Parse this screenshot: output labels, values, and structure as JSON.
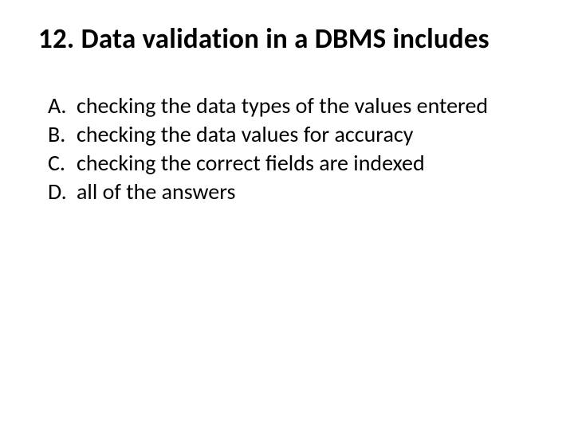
{
  "q": {
    "num": "12.",
    "text": "Data validation in a DBMS includes"
  },
  "o": [
    {
      "l": "A.",
      "t": "checking the data types of the values entered"
    },
    {
      "l": "B.",
      "t": "checking the data values for accuracy"
    },
    {
      "l": "C.",
      "t": "checking the correct fields are indexed"
    },
    {
      "l": "D.",
      "t": "all of the answers"
    }
  ]
}
